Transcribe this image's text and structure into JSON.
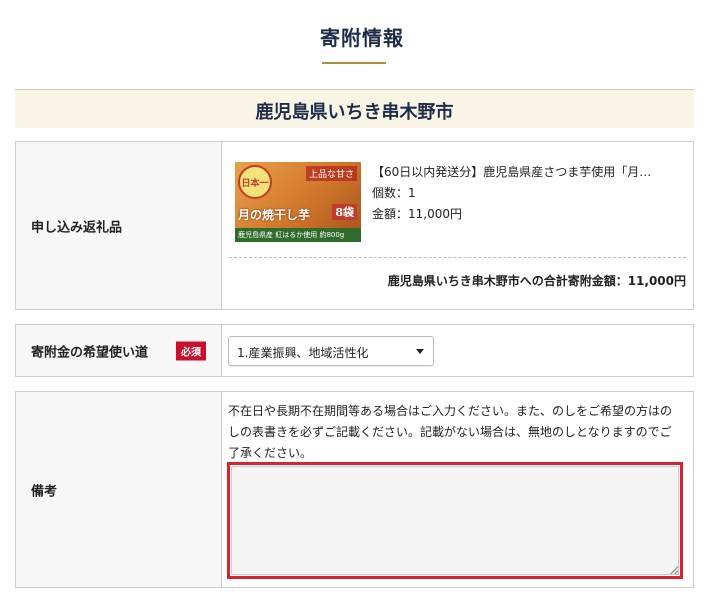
{
  "page": {
    "title": "寄附情報",
    "accent_color": "#b08d3c",
    "error_color": "#d9232e"
  },
  "city": {
    "name": "鹿児島県いちき串木野市"
  },
  "gift": {
    "label": "申し込み返礼品",
    "product": {
      "name": "【60日以内発送分】鹿児島県産さつま芋使用「月…",
      "quantity_text": "個数：1",
      "amount_text": "金額：11,000円",
      "image": {
        "icon": "product-photo",
        "badge": "日本一",
        "tag": "上品な甘さ",
        "title": "月の焼干し芋",
        "count": "8袋",
        "strip": "鹿児島県産 紅はるか使用 約800g"
      }
    },
    "total_text": "鹿児島県いちき串木野市への合計寄附金額：11,000円"
  },
  "usage": {
    "label": "寄附金の希望使い道",
    "required_badge": "必須",
    "selected_option": "1.産業振興、地域活性化"
  },
  "notes": {
    "label": "備考",
    "help_text": "不在日や長期不在期間等ある場合はご入力ください。また、のしをご希望の方はのしの表書きを必ずご記載ください。記載がない場合は、無地のしとなりますのでご了承ください。",
    "value": ""
  }
}
